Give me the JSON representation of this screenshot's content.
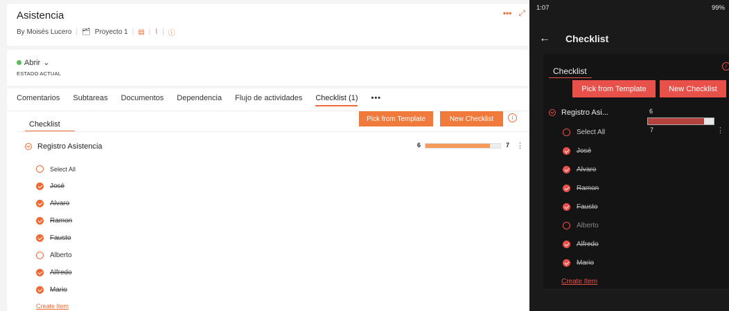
{
  "desktop": {
    "title": "Asistencia",
    "meta": {
      "author": "By Moisés Lucero",
      "project": "Proyecto 1"
    },
    "status": {
      "value": "Abrir",
      "label": "ESTADO ACTUAL"
    },
    "tabs": [
      {
        "label": "Comentarios"
      },
      {
        "label": "Subtareas"
      },
      {
        "label": "Documentos"
      },
      {
        "label": "Dependencia"
      },
      {
        "label": "Flujo de actividades"
      },
      {
        "label": "Checklist (1)"
      }
    ],
    "checklist_title": "Checklist",
    "buttons": {
      "pick_template": "Pick from Template",
      "new_checklist": "New Checklist"
    },
    "group": {
      "name": "Registro Asistencia",
      "done": "6",
      "total": "7",
      "fraction_done": 0.857
    },
    "select_all": "Select All",
    "items": [
      {
        "label": "José",
        "done": true
      },
      {
        "label": "Alvaro",
        "done": true
      },
      {
        "label": "Ramon",
        "done": true
      },
      {
        "label": "Fausto",
        "done": true
      },
      {
        "label": "Alberto",
        "done": false
      },
      {
        "label": "Alfredo",
        "done": true
      },
      {
        "label": "Mario",
        "done": true
      }
    ],
    "create_item": "Create Item",
    "accent_color": "#ef6a35"
  },
  "mobile": {
    "status_bar": {
      "time": "1:07",
      "right": "99%"
    },
    "app_title": "Checklist",
    "checklist_title": "Checklist",
    "buttons": {
      "pick_template": "Pick from Template",
      "new_checklist": "New Checklist"
    },
    "group": {
      "name": "Registro Asi...",
      "done": "6",
      "total": "7",
      "fraction_done": 0.857
    },
    "select_all": "Select All",
    "items": [
      {
        "label": "José",
        "done": true
      },
      {
        "label": "Alvaro",
        "done": true
      },
      {
        "label": "Ramon",
        "done": true
      },
      {
        "label": "Fausto",
        "done": true
      },
      {
        "label": "Alberto",
        "done": false
      },
      {
        "label": "Alfredo",
        "done": true
      },
      {
        "label": "Mario",
        "done": true
      }
    ],
    "create_item": "Create Item",
    "accent_color": "#e8504a"
  }
}
